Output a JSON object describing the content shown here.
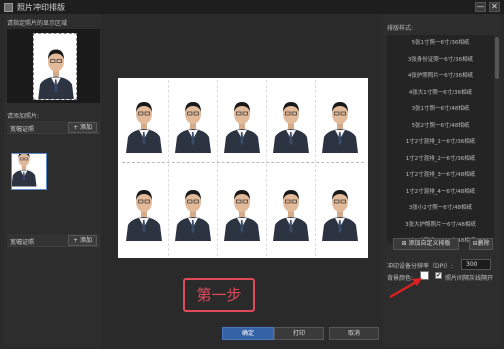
{
  "window": {
    "title": "照片冲印排版",
    "buttons": {
      "minimize": "—",
      "close": "✕"
    }
  },
  "left": {
    "preview_label": "请指定照片的显示区域",
    "add_photo_label": "请添加照片:",
    "sections": [
      {
        "name": "宽幅证照",
        "add_label": "+ 添加"
      },
      {
        "name": "宽幅证照",
        "add_label": "+ 添加"
      }
    ]
  },
  "center": {
    "step_text": "第一步",
    "buttons": {
      "ok": "确定",
      "print": "打印",
      "cancel": "取消"
    }
  },
  "right": {
    "layout_label": "排版样式:",
    "layouts": [
      "5张1寸照一6寸/36相纸",
      "3张身份证照一6寸/36相纸",
      "4张护照照片一6寸/36相纸",
      "4张大1寸照一6寸/36相纸",
      "3张1寸照一6寸/48相纸",
      "5张2寸照一6寸/48相纸",
      "1寸2寸混排_1一6寸/36相纸",
      "1寸2寸混排_2一6寸/36相纸",
      "1寸2寸混排_3一6寸/48相纸",
      "1寸2寸混排_4一6寸/48相纸",
      "3张小2寸照一6寸/48相纸",
      "3张大护照照片一6寸/48相纸",
      "1寸2寸混排_5一6寸/48相纸"
    ],
    "add_custom_label": "添加自定义排版",
    "delete_label": "删除",
    "resolution_label": "冲印设备分辨率（DPI）:",
    "resolution_value": "300",
    "bg_color_label": "背景颜色:",
    "gap_label": "照片间隔灰线隔开",
    "gap_checked": "✔"
  },
  "colors": {
    "accent": "#3561a6",
    "step_red": "#e04a5a",
    "arrow_red": "#e02020"
  }
}
